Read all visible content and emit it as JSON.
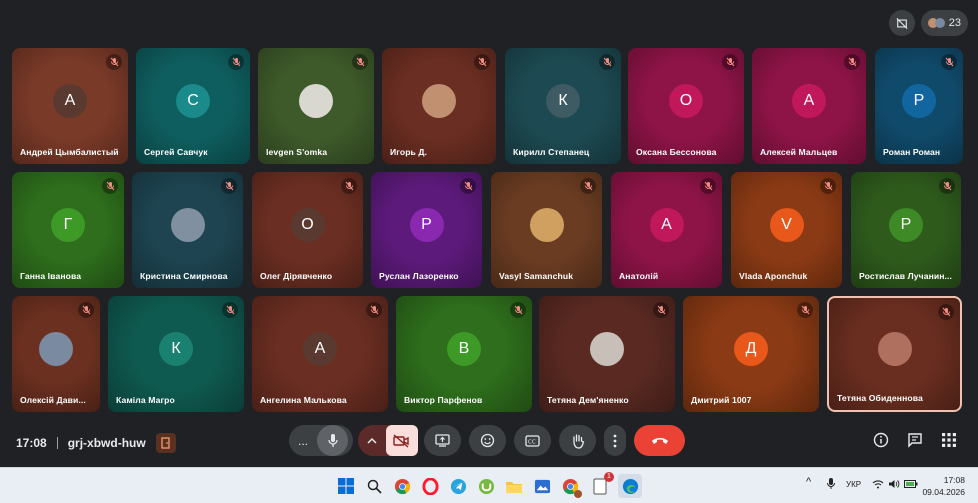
{
  "meeting": {
    "participant_count": "23",
    "time": "17:08",
    "code": "grj-xbwd-huw"
  },
  "participants": [
    {
      "name": "Андрей Цымбалистый",
      "initial": "А",
      "tile_color": "#7a3a28",
      "avatar_color": "#5a3a30"
    },
    {
      "name": "Сергей Савчук",
      "initial": "С",
      "tile_color": "#0f5e5f",
      "avatar_color": "#1a8a8a"
    },
    {
      "name": "Ievgen S'omka",
      "initial": "",
      "tile_color": "#3e5a2a",
      "avatar_color": "#d8d8d0"
    },
    {
      "name": "Игорь Д.",
      "initial": "",
      "tile_color": "#6b2e22",
      "avatar_color": "#c09070"
    },
    {
      "name": "Кирилл Степанец",
      "initial": "К",
      "tile_color": "#1d4a52",
      "avatar_color": "#3e5a62"
    },
    {
      "name": "Оксана Бессонова",
      "initial": "О",
      "tile_color": "#8e1447",
      "avatar_color": "#c0185a"
    },
    {
      "name": "Алексей Мальцев",
      "initial": "А",
      "tile_color": "#8e1447",
      "avatar_color": "#c0185a"
    },
    {
      "name": "Роман Роман",
      "initial": "Р",
      "tile_color": "#104a6a",
      "avatar_color": "#1266a0"
    },
    {
      "name": "Ганна Іванова",
      "initial": "Г",
      "tile_color": "#2e6e1c",
      "avatar_color": "#3d9a26"
    },
    {
      "name": "Кристина Смирнова",
      "initial": "",
      "tile_color": "#1d4450",
      "avatar_color": "#8090a0"
    },
    {
      "name": "Олег Дірявченко",
      "initial": "О",
      "tile_color": "#6b2e22",
      "avatar_color": "#5a3a30"
    },
    {
      "name": "Руслан Лазоренко",
      "initial": "Р",
      "tile_color": "#5c1a7a",
      "avatar_color": "#8a28b0"
    },
    {
      "name": "Vasyl Samanchuk",
      "initial": "",
      "tile_color": "#6a3c22",
      "avatar_color": "#d0a060"
    },
    {
      "name": "Анатолій",
      "initial": "А",
      "tile_color": "#8e1447",
      "avatar_color": "#c0185a"
    },
    {
      "name": "Vlada Aponchuk",
      "initial": "V",
      "tile_color": "#8a3a14",
      "avatar_color": "#e8581a"
    },
    {
      "name": "Ростислав Лучанин...",
      "initial": "Р",
      "tile_color": "#2e5a1c",
      "avatar_color": "#3d8a26"
    },
    {
      "name": "Олексій Дави...",
      "initial": "",
      "tile_color": "#6b3020",
      "avatar_color": "#7a8aa0"
    },
    {
      "name": "Каміла Магро",
      "initial": "К",
      "tile_color": "#0f5a50",
      "avatar_color": "#1a8070"
    },
    {
      "name": "Ангелина Малькова",
      "initial": "А",
      "tile_color": "#6b2e22",
      "avatar_color": "#5a3a30"
    },
    {
      "name": "Виктор Парфенов",
      "initial": "В",
      "tile_color": "#2e6e1c",
      "avatar_color": "#3d9a26"
    },
    {
      "name": "Тетяна Дем'яненко",
      "initial": "",
      "tile_color": "#5a2a22",
      "avatar_color": "#c8c0b8"
    },
    {
      "name": "Дмитрий 1007",
      "initial": "Д",
      "tile_color": "#8a3a14",
      "avatar_color": "#e8581a"
    },
    {
      "name": "Тетяна Обиденнова",
      "initial": "",
      "tile_color": "#6a2e20",
      "avatar_color": "#b07060"
    }
  ],
  "controls": {
    "more_label": "...",
    "icons": [
      "mic-icon",
      "chevron-up-icon",
      "camera-off-icon",
      "present-icon",
      "emoji-icon",
      "captions-icon",
      "raise-hand-icon",
      "more-vert-icon",
      "end-call-icon"
    ]
  },
  "taskbar": {
    "language": "УКР",
    "time": "17:08",
    "date": "09.04.2026",
    "badge": "1"
  },
  "colors": {
    "end_call": "#ea4335",
    "camera_off_bg": "#f9dedc",
    "bar_bg": "#202124",
    "control_bg": "#3c4043"
  }
}
